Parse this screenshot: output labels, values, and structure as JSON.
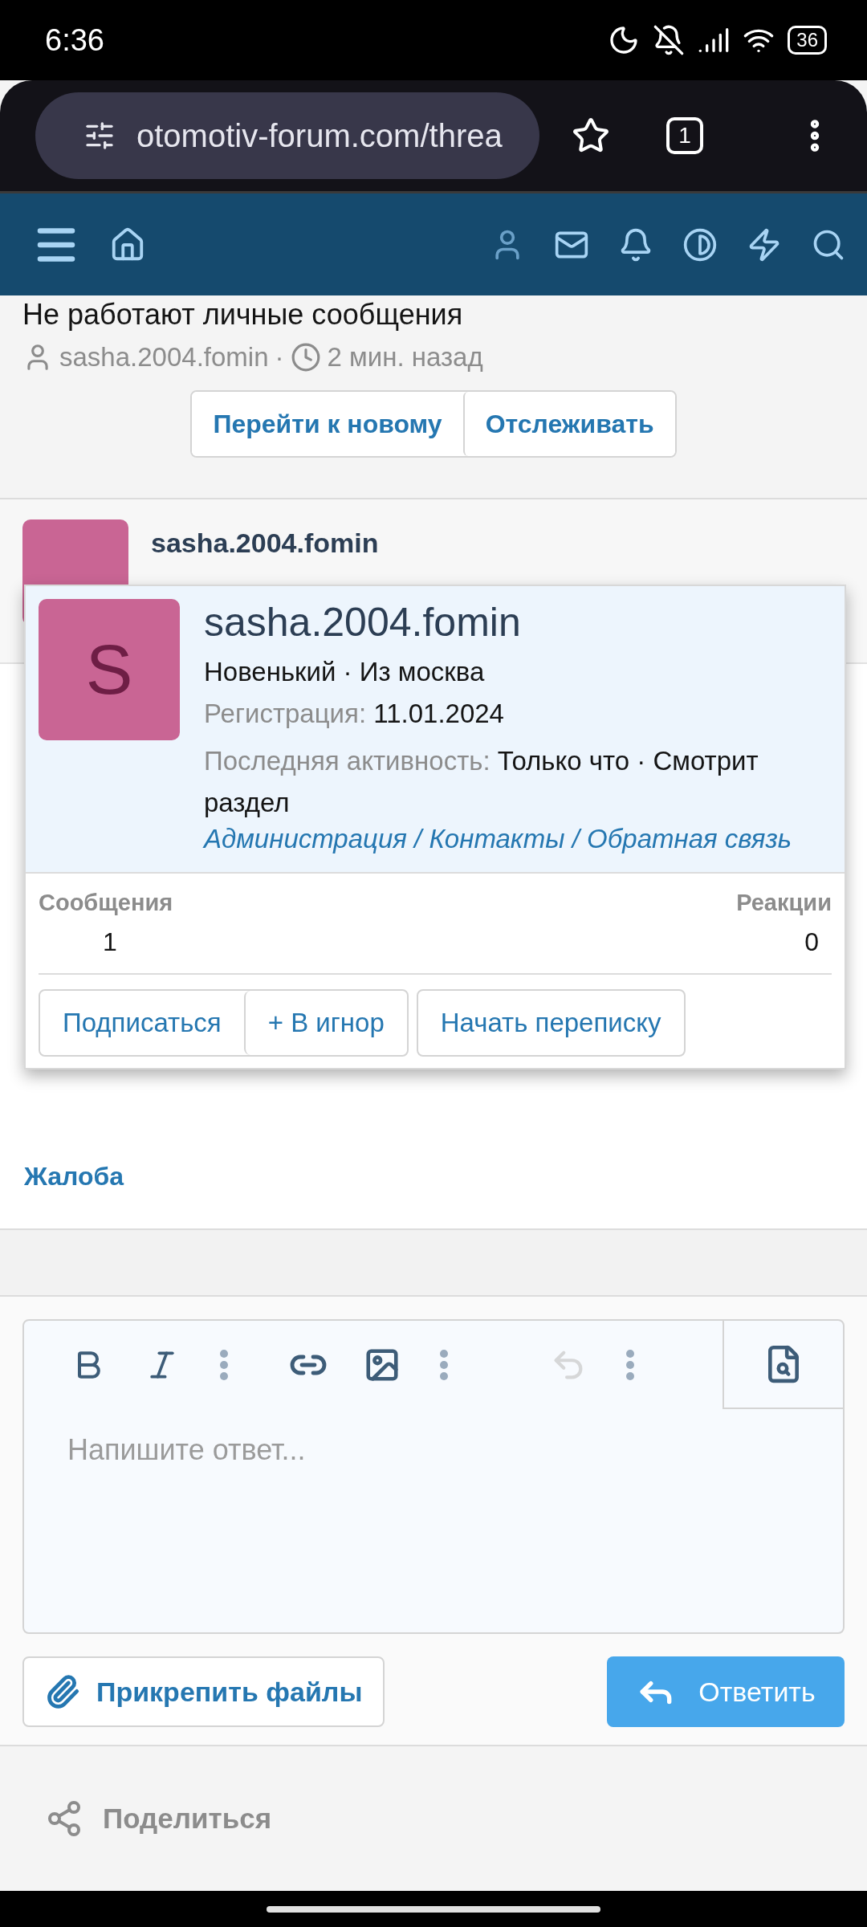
{
  "status_bar": {
    "time": "6:36",
    "battery": "36"
  },
  "browser": {
    "url": "otomotiv-forum.com/threa",
    "tab_count": "1"
  },
  "thread": {
    "title": "Не работают личные сообщения",
    "author": "sasha.2004.fomin",
    "separator": "·",
    "time": "2 мин. назад",
    "buttons": [
      "Перейти к новому",
      "Отслеживать"
    ]
  },
  "post": {
    "author": "sasha.2004.fomin",
    "report_link": "Жалоба"
  },
  "member_card": {
    "avatar_letter": "S",
    "name": "sasha.2004.fomin",
    "title_line": "Новенький · Из москва",
    "registration_label": "Регистрация:",
    "registration_value": "11.01.2024",
    "activity_label": "Последняя активность:",
    "activity_value": "Только что · Смотрит раздел",
    "activity_link": "Администрация / Контакты / Обратная связь",
    "stats": [
      {
        "label": "Сообщения",
        "value": "1"
      },
      {
        "label": "Реакции",
        "value": "0"
      }
    ],
    "buttons": [
      "Подписаться",
      "+ В игнор",
      "Начать переписку"
    ]
  },
  "editor": {
    "placeholder": "Напишите ответ...",
    "tools": [
      {
        "kind": "bold",
        "disabled": false
      },
      {
        "kind": "italic",
        "disabled": false
      },
      {
        "kind": "more",
        "disabled": false
      },
      {
        "kind": "link",
        "disabled": false
      },
      {
        "kind": "image",
        "disabled": false
      },
      {
        "kind": "more",
        "disabled": false
      },
      {
        "kind": "undo",
        "disabled": true
      },
      {
        "kind": "more",
        "disabled": false
      }
    ]
  },
  "attach_button": "Прикрепить файлы",
  "reply_button": "Ответить",
  "share_link": "Поделиться"
}
